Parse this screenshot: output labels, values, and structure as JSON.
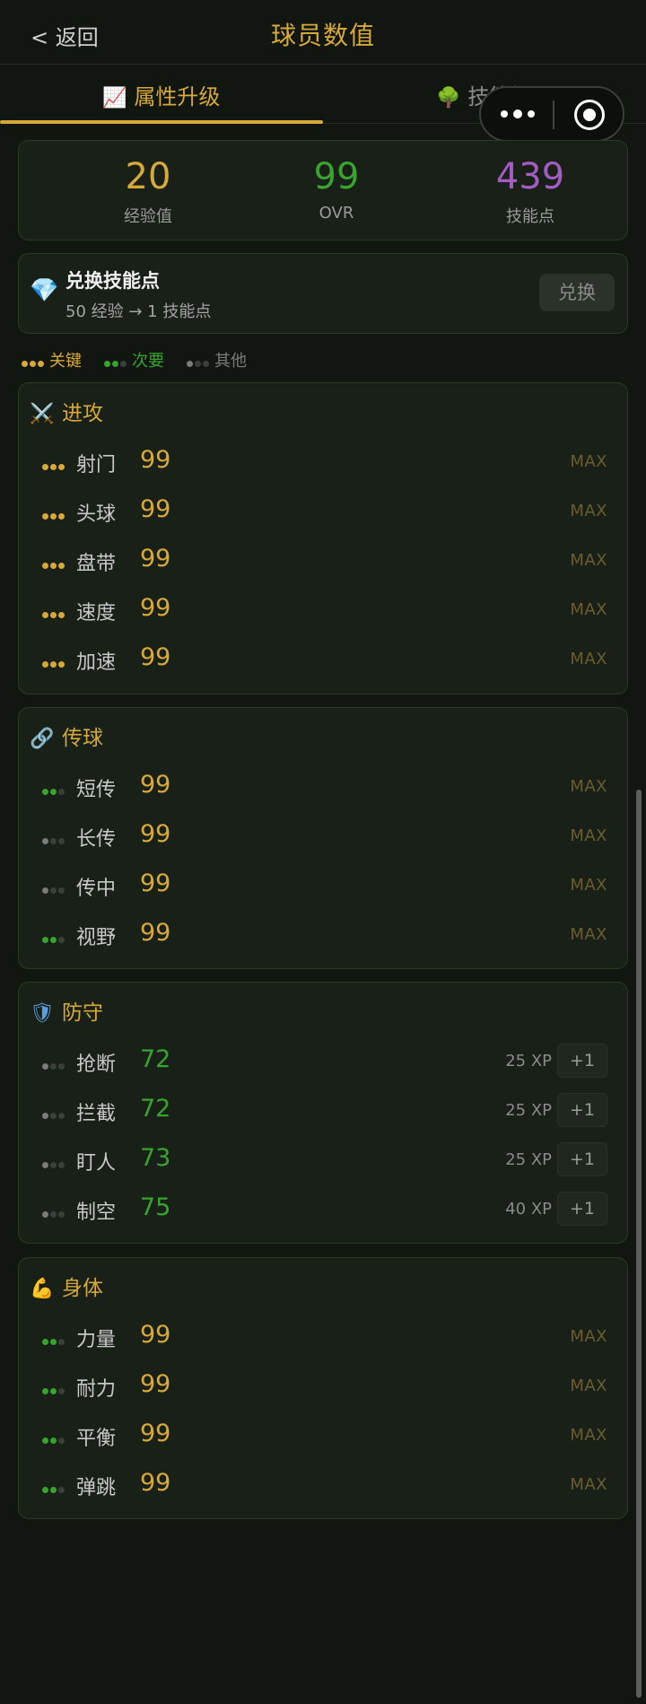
{
  "header": {
    "back_label": "< 返回",
    "title": "球员数值"
  },
  "tabs": [
    {
      "icon": "📈",
      "label": "属性升级",
      "active": true
    },
    {
      "icon": "🌳",
      "label": "技能树",
      "active": false
    }
  ],
  "stats": [
    {
      "value": "20",
      "label": "经验值",
      "color": "#d6a93a"
    },
    {
      "value": "99",
      "label": "OVR",
      "color": "#39a32f"
    },
    {
      "value": "439",
      "label": "技能点",
      "color": "#a35cc2"
    }
  ],
  "exchange": {
    "icon": "💎",
    "title": "兑换技能点",
    "subtitle": "50 经验 → 1 技能点",
    "button": "兑换"
  },
  "legend": [
    {
      "label": "关键",
      "level": 3,
      "color": "#d6a93a"
    },
    {
      "label": "次要",
      "level": 2,
      "color": "#39a32f"
    },
    {
      "label": "其他",
      "level": 1,
      "color": "#7b7b7b"
    }
  ],
  "sections": [
    {
      "icon": "⚔️",
      "title": "进攻",
      "rows": [
        {
          "name": "射门",
          "value": "99",
          "tier": 3,
          "status": "MAX"
        },
        {
          "name": "头球",
          "value": "99",
          "tier": 3,
          "status": "MAX"
        },
        {
          "name": "盘带",
          "value": "99",
          "tier": 3,
          "status": "MAX"
        },
        {
          "name": "速度",
          "value": "99",
          "tier": 3,
          "status": "MAX"
        },
        {
          "name": "加速",
          "value": "99",
          "tier": 3,
          "status": "MAX"
        }
      ]
    },
    {
      "icon": "🔗",
      "title": "传球",
      "rows": [
        {
          "name": "短传",
          "value": "99",
          "tier": 2,
          "status": "MAX"
        },
        {
          "name": "长传",
          "value": "99",
          "tier": 1,
          "status": "MAX"
        },
        {
          "name": "传中",
          "value": "99",
          "tier": 1,
          "status": "MAX"
        },
        {
          "name": "视野",
          "value": "99",
          "tier": 2,
          "status": "MAX"
        }
      ]
    },
    {
      "icon": "🛡",
      "title": "防守",
      "rows": [
        {
          "name": "抢断",
          "value": "72",
          "tier": 1,
          "xp": "25 XP",
          "plus": "+1"
        },
        {
          "name": "拦截",
          "value": "72",
          "tier": 1,
          "xp": "25 XP",
          "plus": "+1"
        },
        {
          "name": "盯人",
          "value": "73",
          "tier": 1,
          "xp": "25 XP",
          "plus": "+1"
        },
        {
          "name": "制空",
          "value": "75",
          "tier": 1,
          "xp": "40 XP",
          "plus": "+1"
        }
      ]
    },
    {
      "icon": "💪",
      "title": "身体",
      "rows": [
        {
          "name": "力量",
          "value": "99",
          "tier": 2,
          "status": "MAX"
        },
        {
          "name": "耐力",
          "value": "99",
          "tier": 2,
          "status": "MAX"
        },
        {
          "name": "平衡",
          "value": "99",
          "tier": 2,
          "status": "MAX"
        },
        {
          "name": "弹跳",
          "value": "99",
          "tier": 2,
          "status": "MAX"
        }
      ]
    }
  ],
  "colors": {
    "gold": "#d6a93a",
    "green": "#39a32f",
    "purple": "#a35cc2",
    "dim": "#3a3f3a",
    "grey": "#7b7b7b"
  }
}
